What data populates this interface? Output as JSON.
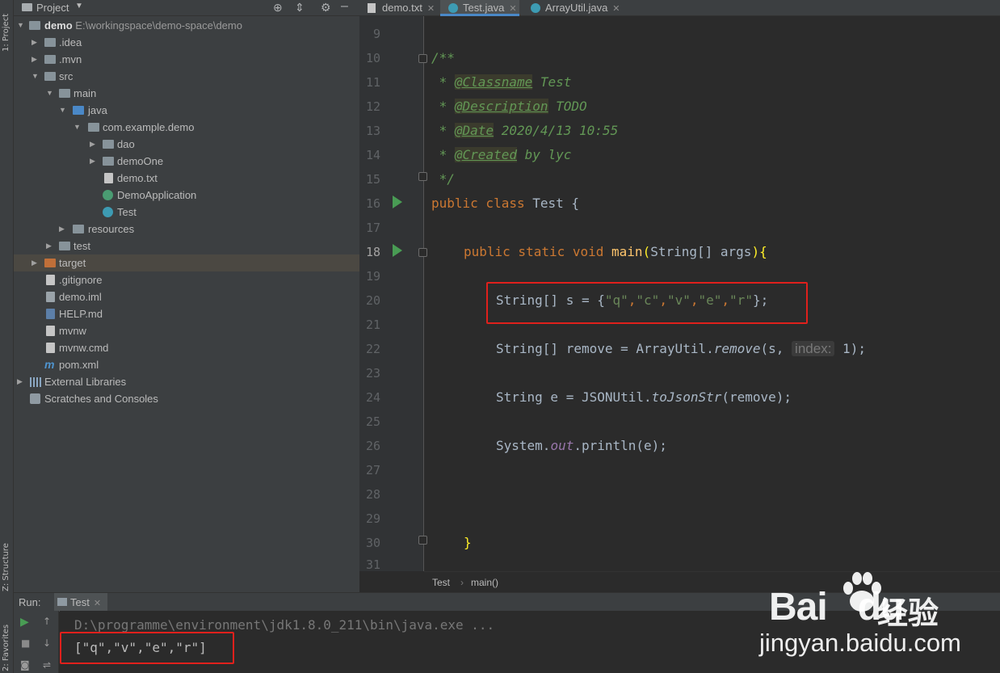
{
  "left_strip": {
    "project_tab": "1: Project",
    "structure_tab": "Z: Structure",
    "favorites_tab": "2: Favorites"
  },
  "project_panel": {
    "title": "Project",
    "tree": [
      {
        "label": "demo",
        "path": "E:\\workingspace\\demo-space\\demo",
        "icon": "folder-icon",
        "expanded": true
      },
      {
        "label": ".idea",
        "icon": "folder-icon",
        "expanded": false
      },
      {
        "label": ".mvn",
        "icon": "folder-icon",
        "expanded": false
      },
      {
        "label": "src",
        "icon": "folder-icon",
        "expanded": true
      },
      {
        "label": "main",
        "icon": "folder-icon",
        "expanded": true
      },
      {
        "label": "java",
        "icon": "source-folder-icon",
        "expanded": true
      },
      {
        "label": "com.example.demo",
        "icon": "package-icon",
        "expanded": true
      },
      {
        "label": "dao",
        "icon": "package-icon",
        "expanded": false
      },
      {
        "label": "demoOne",
        "icon": "package-icon",
        "expanded": false
      },
      {
        "label": "demo.txt",
        "icon": "text-file-icon"
      },
      {
        "label": "DemoApplication",
        "icon": "spring-class-icon"
      },
      {
        "label": "Test",
        "icon": "class-icon"
      },
      {
        "label": "resources",
        "icon": "resources-folder-icon",
        "expanded": false
      },
      {
        "label": "test",
        "icon": "folder-icon",
        "expanded": false
      },
      {
        "label": "target",
        "icon": "excluded-folder-icon",
        "expanded": false,
        "selected": true
      },
      {
        "label": ".gitignore",
        "icon": "text-file-icon"
      },
      {
        "label": "demo.iml",
        "icon": "module-file-icon"
      },
      {
        "label": "HELP.md",
        "icon": "markdown-file-icon"
      },
      {
        "label": "mvnw",
        "icon": "text-file-icon"
      },
      {
        "label": "mvnw.cmd",
        "icon": "text-file-icon"
      },
      {
        "label": "pom.xml",
        "icon": "maven-icon"
      },
      {
        "label": "External Libraries",
        "icon": "libraries-icon",
        "expanded": false
      },
      {
        "label": "Scratches and Consoles",
        "icon": "scratches-icon"
      }
    ]
  },
  "editor": {
    "tabs": [
      {
        "label": "demo.txt",
        "active": false
      },
      {
        "label": "Test.java",
        "active": true
      },
      {
        "label": "ArrayUtil.java",
        "active": false
      }
    ],
    "line_numbers": [
      "9",
      "10",
      "11",
      "12",
      "13",
      "14",
      "15",
      "16",
      "17",
      "18",
      "19",
      "20",
      "21",
      "22",
      "23",
      "24",
      "25",
      "26",
      "27",
      "28",
      "29",
      "30",
      "31"
    ],
    "code": {
      "l10": "/**",
      "l11_tag": "@Classname",
      "l11_text": " Test",
      "l12_tag": "@Description",
      "l12_text": " TODO",
      "l13_tag": "@Date",
      "l13_text": " 2020/4/13 10:55",
      "l14_tag": "@Created",
      "l14_text": " by lyc",
      "l15": " */",
      "l16_kw": "public class",
      "l16_rest": " Test {",
      "l18_kw": "public static void",
      "l18_fn": "main",
      "l18_args": "String[] args",
      "l20_pre": "String[] s = {",
      "l20_vals": [
        "\"q\"",
        "\"c\"",
        "\"v\"",
        "\"e\"",
        "\"r\""
      ],
      "l20_post": "};",
      "l22_pre": "String[] remove = ArrayUtil.",
      "l22_fn": "remove",
      "l22_arg": "(s, ",
      "l22_hint": "index:",
      "l22_post": " 1);",
      "l24_pre": "String e = JSONUtil.",
      "l24_fn": "toJsonStr",
      "l24_post": "(remove);",
      "l26_pre": "System.",
      "l26_field": "out",
      "l26_post": ".println(e);",
      "l30": "}"
    },
    "breadcrumb": [
      "Test",
      "main()"
    ]
  },
  "run_panel": {
    "label": "Run:",
    "tab": "Test",
    "command": "D:\\programme\\environment\\jdk1.8.0_211\\bin\\java.exe ...",
    "output": "[\"q\",\"v\",\"e\",\"r\"]"
  },
  "watermark": {
    "brand": "Bai",
    "brand2": "du",
    "brand_cn": "经验",
    "url": "jingyan.baidu.com"
  }
}
